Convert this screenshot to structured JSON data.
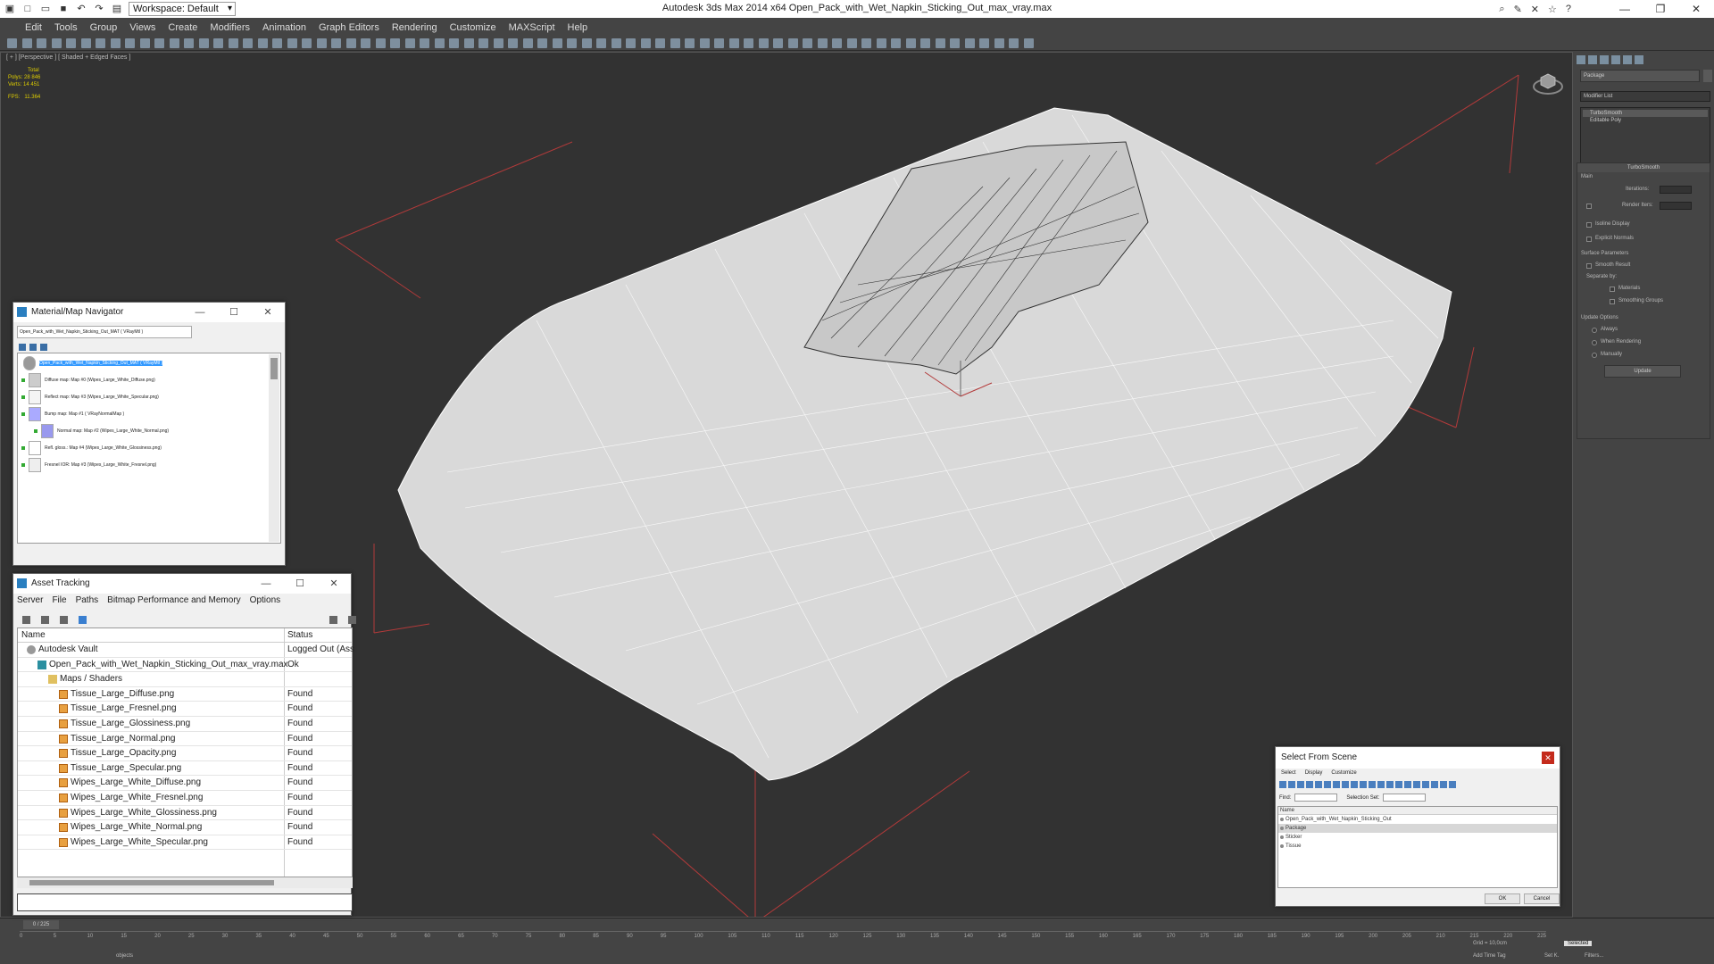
{
  "titlebar": {
    "workspace": "Workspace: Default",
    "title": "Autodesk 3ds Max  2014 x64     Open_Pack_with_Wet_Napkin_Sticking_Out_max_vray.max"
  },
  "menu": [
    "Edit",
    "Tools",
    "Group",
    "Views",
    "Create",
    "Modifiers",
    "Animation",
    "Graph Editors",
    "Rendering",
    "Customize",
    "MAXScript",
    "Help"
  ],
  "viewport": {
    "label": "[ + ] [Perspective ] [ Shaded + Edged Faces ]",
    "stats": {
      "total_label": "Total",
      "polys_label": "Polys:",
      "polys": "28 846",
      "verts_label": "Verts:",
      "verts": "14 451",
      "fps_label": "FPS:",
      "fps": "11.364"
    }
  },
  "material_navigator": {
    "title": "Material/Map Navigator",
    "field": "Open_Pack_with_Wet_Napkin_Sticking_Out_MAT  ( VRayMtl )",
    "items": [
      {
        "text": "Open_Pack_with_Wet_Napkin_Sticking_Out_MAT  ( VRayMtl )",
        "selected": true
      },
      {
        "text": "Diffuse map: Map #0 (Wipes_Large_White_Diffuse.png)"
      },
      {
        "text": "Reflect map: Map #3 (Wipes_Large_White_Specular.png)"
      },
      {
        "text": "Bump map: Map #1  ( VRayNormalMap )"
      },
      {
        "text": "Normal map: Map #2 (Wipes_Large_White_Normal.png)"
      },
      {
        "text": "Refl. gloss.: Map #4 (Wipes_Large_White_Glossiness.png)"
      },
      {
        "text": "Fresnel IOR: Map #3 (Wipes_Large_White_Fresnel.png)"
      }
    ]
  },
  "asset_tracking": {
    "title": "Asset Tracking",
    "menu": [
      "Server",
      "File",
      "Paths",
      "Bitmap Performance and Memory",
      "Options"
    ],
    "columns": {
      "name": "Name",
      "status": "Status"
    },
    "rows": [
      {
        "name": "Autodesk Vault",
        "status": "Logged Out (Ass",
        "indent": 1,
        "icon": "vault"
      },
      {
        "name": "Open_Pack_with_Wet_Napkin_Sticking_Out_max_vray.max",
        "status": "Ok",
        "indent": 2,
        "icon": "max"
      },
      {
        "name": "Maps / Shaders",
        "status": "",
        "indent": 3,
        "icon": "folder"
      },
      {
        "name": "Tissue_Large_Diffuse.png",
        "status": "Found",
        "indent": 4,
        "icon": "png"
      },
      {
        "name": "Tissue_Large_Fresnel.png",
        "status": "Found",
        "indent": 4,
        "icon": "png"
      },
      {
        "name": "Tissue_Large_Glossiness.png",
        "status": "Found",
        "indent": 4,
        "icon": "png"
      },
      {
        "name": "Tissue_Large_Normal.png",
        "status": "Found",
        "indent": 4,
        "icon": "png"
      },
      {
        "name": "Tissue_Large_Opacity.png",
        "status": "Found",
        "indent": 4,
        "icon": "png"
      },
      {
        "name": "Tissue_Large_Specular.png",
        "status": "Found",
        "indent": 4,
        "icon": "png"
      },
      {
        "name": "Wipes_Large_White_Diffuse.png",
        "status": "Found",
        "indent": 4,
        "icon": "png"
      },
      {
        "name": "Wipes_Large_White_Fresnel.png",
        "status": "Found",
        "indent": 4,
        "icon": "png"
      },
      {
        "name": "Wipes_Large_White_Glossiness.png",
        "status": "Found",
        "indent": 4,
        "icon": "png"
      },
      {
        "name": "Wipes_Large_White_Normal.png",
        "status": "Found",
        "indent": 4,
        "icon": "png"
      },
      {
        "name": "Wipes_Large_White_Specular.png",
        "status": "Found",
        "indent": 4,
        "icon": "png"
      }
    ]
  },
  "select_from_scene": {
    "title": "Select From Scene",
    "menu": [
      "Select",
      "Display",
      "Customize"
    ],
    "find_label": "Find:",
    "selection_set_label": "Selection Set:",
    "column": "Name",
    "items": [
      {
        "name": "Open_Pack_with_Wet_Napkin_Sticking_Out",
        "selected": false
      },
      {
        "name": "Package",
        "selected": true
      },
      {
        "name": "Sticker",
        "selected": false
      },
      {
        "name": "Tissue",
        "selected": false
      }
    ],
    "ok": "OK",
    "cancel": "Cancel"
  },
  "command_panel": {
    "object_name": "Package",
    "modifier_list": "Modifier List",
    "stack": [
      "TurboSmooth",
      "Editable Poly"
    ],
    "turbosmooth": {
      "title": "TurboSmooth",
      "main": "Main",
      "iterations": "Iterations:",
      "render_iters": "Render Iters:",
      "isoline": "Isoline Display",
      "explicit": "Explicit Normals",
      "surface": "Surface Parameters",
      "smooth": "Smooth Result",
      "separate": "Separate by:",
      "materials": "Materials",
      "groups": "Smoothing Groups",
      "update_opts": "Update Options",
      "always": "Always",
      "when": "When Rendering",
      "manually": "Manually",
      "update": "Update"
    }
  },
  "timeline": {
    "frame": "0 / 225",
    "ticks": [
      "0",
      "5",
      "10",
      "15",
      "20",
      "25",
      "30",
      "35",
      "40",
      "45",
      "50",
      "55",
      "60",
      "65",
      "70",
      "75",
      "80",
      "85",
      "90",
      "95",
      "100",
      "105",
      "110",
      "115",
      "120",
      "125",
      "130",
      "135",
      "140",
      "145",
      "150",
      "155",
      "160",
      "165",
      "170",
      "175",
      "180",
      "185",
      "190",
      "195",
      "200",
      "205",
      "210",
      "215",
      "220",
      "225"
    ]
  },
  "status": {
    "objects": "objects",
    "grid": "Grid = 10,0cm",
    "addtimetag": "Add Time Tag",
    "selected": "Selected",
    "setkey": "Set K.",
    "filters": "Filters..."
  }
}
